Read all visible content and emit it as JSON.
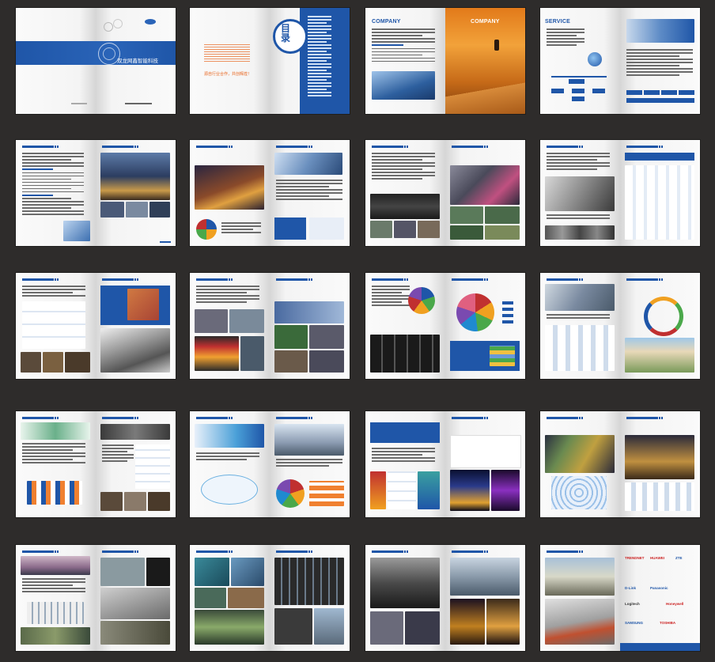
{
  "cover": {
    "company_name": "双龙网鑫智能科技",
    "slogan": "源自行业合作，共创辉煌！",
    "toc_title": "目录"
  },
  "section_titles": {
    "company_left": "COMPANY",
    "company_right": "COMPANY",
    "service": "SERVICE"
  },
  "brand_logos": [
    "TRENDNET",
    "HUAWEI",
    "ZTE",
    "D-Link",
    "Panasonic",
    "Logitech",
    "Honeywell",
    "SAMSUNG",
    "TOSHIBA"
  ],
  "colors": {
    "background": "#2e2c2b",
    "brand_blue": "#1f56a8",
    "accent_orange": "#e8641c"
  }
}
